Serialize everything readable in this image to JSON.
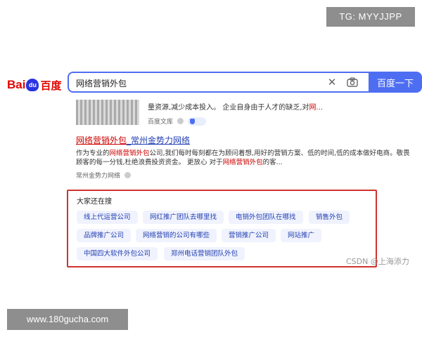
{
  "tg_badge": "TG: MYYJJPP",
  "header": {
    "logo": {
      "part1": "Bai",
      "paw": "du",
      "part2": "百度"
    },
    "search_value": "网络营销外包",
    "clear_icon": "close-icon",
    "camera_icon": "camera-icon",
    "search_button": "百度一下",
    "accent_color": "#4e6ef2"
  },
  "result1": {
    "line": "量资源,减少成本投入。 企业自身由于人才的缺乏,对",
    "line_tail": "网...",
    "source": "百度文库",
    "badge": "shield-icon"
  },
  "result2": {
    "title_highlight": "网络营销外包",
    "title_rest": "_常州金势力网络",
    "body_1": "作为专业的",
    "body_hl1": "网络营销外包",
    "body_2": "公司,我们每时每刻都在为顾问着想,用好的营销方案、低的时间,低的成本做好电商。敬畏顾客的每一分钱,杜绝浪费投资资金。 更放心 对于",
    "body_hl2": "网络营销外包",
    "body_3": "的客...",
    "source": "常州金势力网络"
  },
  "related": {
    "title": "大家还在搜",
    "border_color": "#d0322e",
    "items": [
      "线上代运营公司",
      "网红推广团队去哪里找",
      "电销外包团队在哪找",
      "销售外包",
      "品牌推广公司",
      "网络营销的公司有哪些",
      "营销推广公司",
      "网站推广",
      "中国四大软件外包公司",
      "郑州电话营销团队外包"
    ]
  },
  "watermark": "CSDN @上海添力",
  "site_badge": "www.180gucha.com"
}
